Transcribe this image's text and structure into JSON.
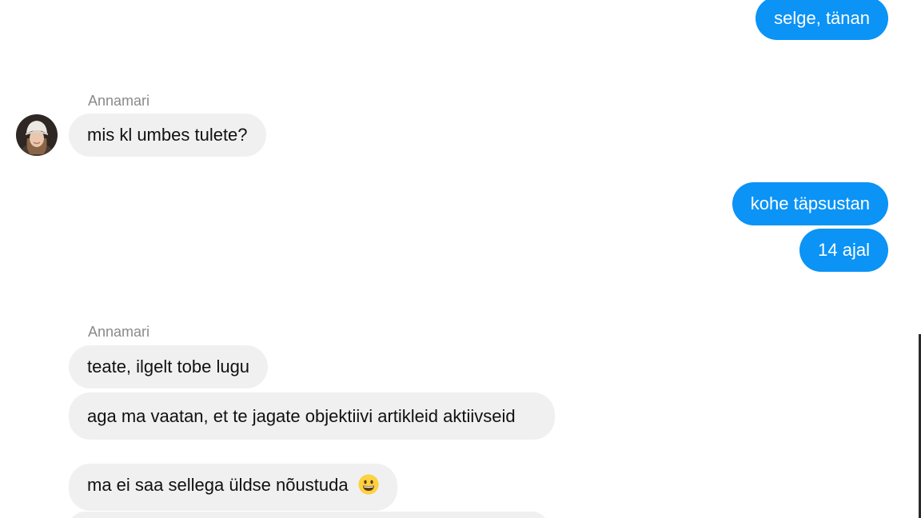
{
  "colors": {
    "outgoing_bubble": "#0b93f6",
    "incoming_bubble": "#f0f0f0",
    "sender_name": "#8a8a8a"
  },
  "conversation": {
    "messages": [
      {
        "direction": "outgoing",
        "text": "selge, tänan"
      },
      {
        "direction": "incoming",
        "sender": "Annamari",
        "text": "mis kl umbes tulete?"
      },
      {
        "direction": "outgoing",
        "text": "kohe täpsustan"
      },
      {
        "direction": "outgoing",
        "text": "14 ajal"
      },
      {
        "direction": "incoming",
        "sender": "Annamari",
        "text": "teate, ilgelt tobe lugu"
      },
      {
        "direction": "incoming",
        "text": "aga ma vaatan, et te jagate objektiivi artikleid aktiivseid"
      },
      {
        "direction": "incoming",
        "text": "ma ei saa sellega üldse nõustuda",
        "emoji": "grinning-face-icon"
      }
    ]
  },
  "icons": {
    "avatar": "user-avatar-icon",
    "emoji": "grinning-face-icon"
  }
}
